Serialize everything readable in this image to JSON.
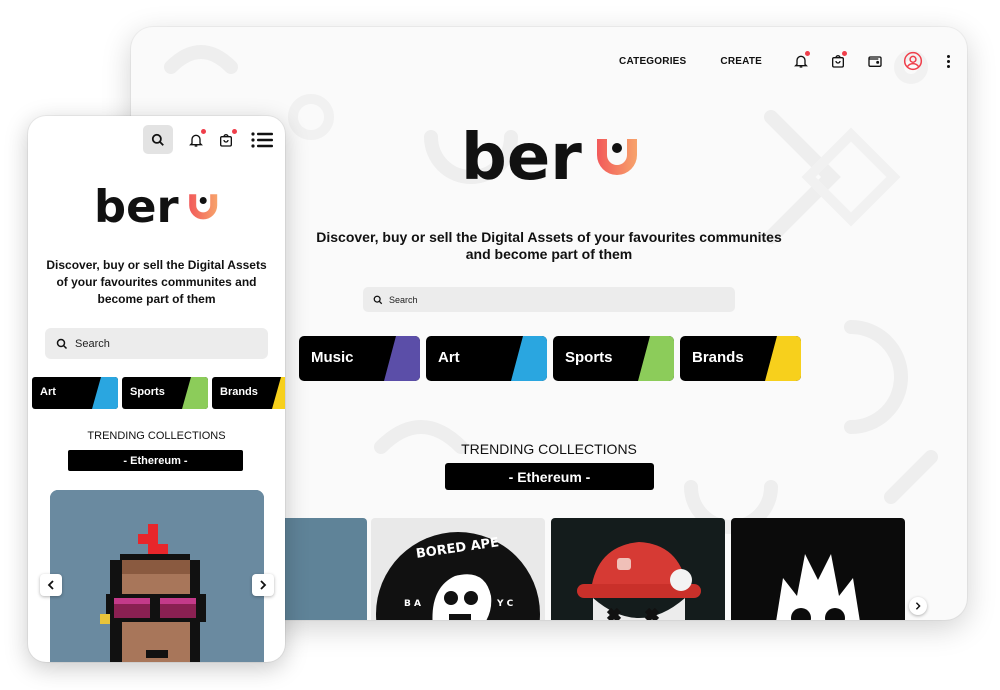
{
  "colors": {
    "accent_red": "#ef3e4a",
    "logo_gradient_start": "#f25a5a",
    "logo_gradient_end": "#f7a36b",
    "music": "#5b4ea8",
    "art": "#2aa6e0",
    "sports": "#8ccc5a",
    "brands": "#f7d01c"
  },
  "desktop": {
    "nav": {
      "categories_label": "CATEGORIES",
      "create_label": "CREATE",
      "icons": [
        "bell-icon",
        "cart-icon",
        "wallet-icon",
        "user-avatar-icon",
        "more-vertical-icon"
      ]
    },
    "logo_text": "beru",
    "tagline": "Discover, buy or sell the Digital Assets of your favourites communites and become part of them",
    "search": {
      "placeholder": "Search"
    },
    "categories": [
      {
        "label": "Music",
        "color": "#5b4ea8"
      },
      {
        "label": "Art",
        "color": "#2aa6e0"
      },
      {
        "label": "Sports",
        "color": "#8ccc5a"
      },
      {
        "label": "Brands",
        "color": "#f7d01c"
      }
    ],
    "trending": {
      "title": "TRENDING COLLECTIONS",
      "network": "- Ethereum -"
    },
    "collection_cards": [
      {
        "name": "punk-card",
        "text": ""
      },
      {
        "name": "bored-ape-card",
        "text": "BORED APE",
        "left_letters": "B A",
        "right_letters": "Y C"
      },
      {
        "name": "skull-helmet-card",
        "text": ""
      },
      {
        "name": "white-creature-card",
        "text": ""
      }
    ]
  },
  "mobile": {
    "logo_text": "beru",
    "tagline": "Discover, buy or sell the Digital Assets of your favourites communites and become part of them",
    "search": {
      "placeholder": "Search"
    },
    "categories": [
      {
        "label": "Art",
        "color": "#2aa6e0"
      },
      {
        "label": "Sports",
        "color": "#8ccc5a"
      },
      {
        "label": "Brands",
        "color": "#f7d01c"
      }
    ],
    "trending": {
      "title": "TRENDING COLLECTIONS",
      "network": "- Ethereum -"
    }
  }
}
